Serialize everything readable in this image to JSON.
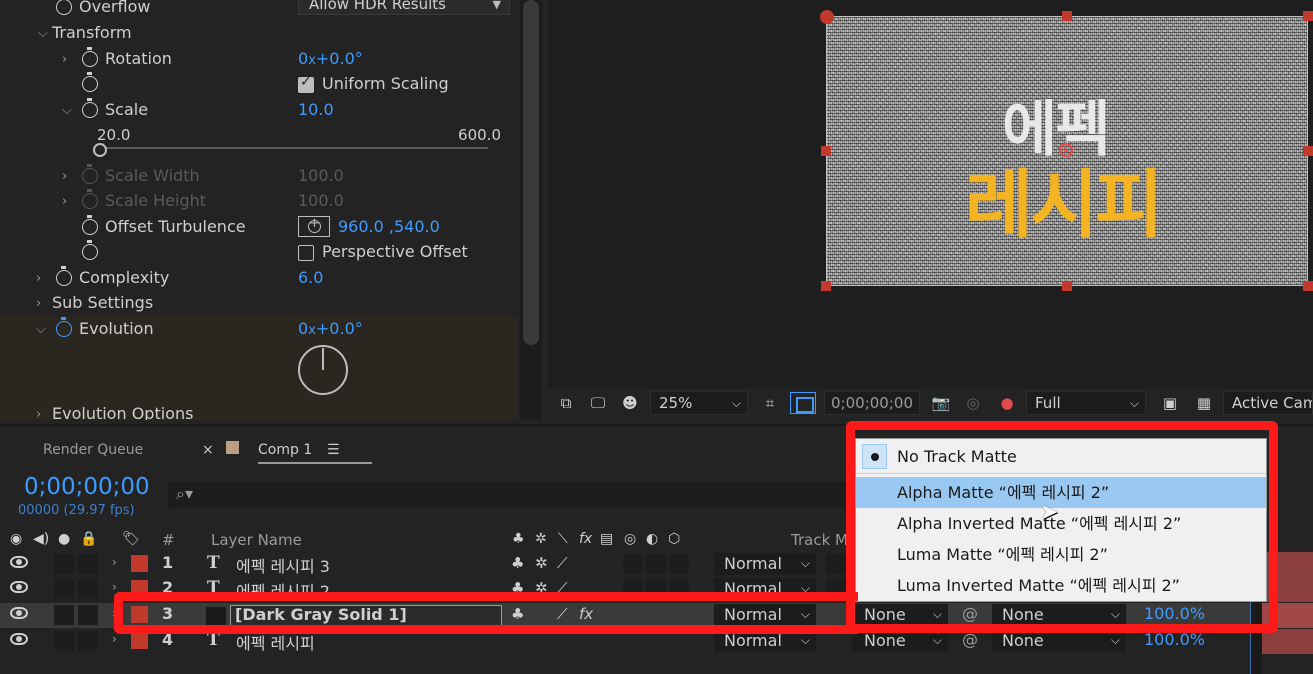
{
  "effect_controls": {
    "overflow": {
      "label": "Overflow",
      "value": "Allow HDR Results"
    },
    "transform": {
      "label": "Transform"
    },
    "rotation": {
      "label": "Rotation",
      "value_a": "0",
      "value_x": "x",
      "value_b": "+0.0",
      "degree": "°"
    },
    "uniform_scaling": {
      "label": "Uniform Scaling",
      "checked": true
    },
    "scale": {
      "label": "Scale",
      "value": "10.0",
      "slider_min": "20.0",
      "slider_max": "600.0"
    },
    "scale_width": {
      "label": "Scale Width",
      "value": "100.0"
    },
    "scale_height": {
      "label": "Scale Height",
      "value": "100.0"
    },
    "offset_turbulence": {
      "label": "Offset Turbulence",
      "value": "960.0 ,540.0"
    },
    "perspective_offset": {
      "label": "Perspective Offset",
      "checked": false
    },
    "complexity": {
      "label": "Complexity",
      "value": "6.0"
    },
    "sub_settings": {
      "label": "Sub Settings"
    },
    "evolution": {
      "label": "Evolution",
      "value_a": "0",
      "value_x": "x",
      "value_b": "+0.0",
      "degree": "°"
    },
    "evolution_options": {
      "label": "Evolution Options"
    }
  },
  "viewer": {
    "comp_text_line1": "에펙",
    "comp_text_line2": "레시피",
    "zoom": "25%",
    "timecode": "0;00;00;00",
    "resolution": "Full",
    "camera": "Active Camera"
  },
  "timeline": {
    "tabs": {
      "render_queue": "Render Queue",
      "comp": "Comp 1",
      "close": "×",
      "menu": "☰"
    },
    "timecode": "0;00;00;00",
    "fps": "00000 (29.97 fps)",
    "search_icon": "⌕▾",
    "headers": {
      "number": "#",
      "layer_name": "Layer Name",
      "track_matte": "Track Matte",
      "fx": "fx"
    },
    "layers": [
      {
        "num": "1",
        "type": "T",
        "name": "에펙 레시피 3",
        "mode": "Normal"
      },
      {
        "num": "2",
        "type": "T",
        "name": "에펙 레시피 2",
        "mode": "Normal"
      },
      {
        "num": "3",
        "type": "",
        "name": "[Dark Gray Solid 1]",
        "mode": "Normal",
        "track_matte": "None",
        "parent": "None",
        "opacity": "100.0%"
      },
      {
        "num": "4",
        "type": "T",
        "name": "에펙 레시피",
        "mode": "Normal",
        "track_matte": "None",
        "parent": "None",
        "opacity": "100.0%"
      }
    ]
  },
  "track_matte_menu": {
    "items": [
      {
        "label": "No Track Matte",
        "checked": true
      },
      {
        "label": "Alpha Matte “에펙 레시피 2”",
        "highlighted": true
      },
      {
        "label": "Alpha Inverted Matte “에펙 레시피 2”"
      },
      {
        "label": "Luma Matte “에펙 레시피 2”"
      },
      {
        "label": "Luma Inverted Matte “에펙 레시피 2”"
      }
    ]
  },
  "colors": {
    "accent_blue": "#3d9bff",
    "highlight_red": "#ff1a1a",
    "label_red": "#c0392b",
    "text_orange": "#f4b323"
  }
}
